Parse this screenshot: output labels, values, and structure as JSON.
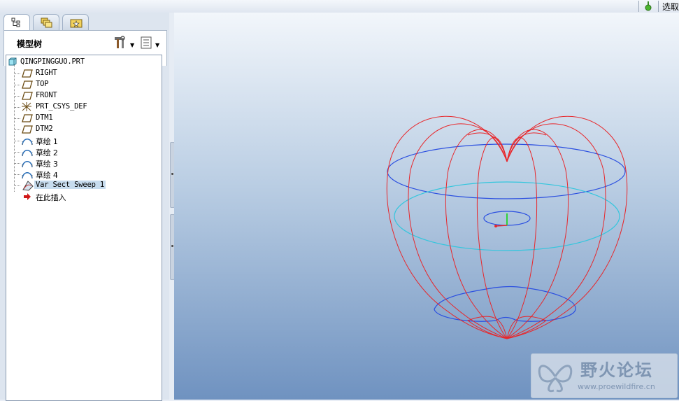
{
  "topbar": {
    "filter_label": "选取"
  },
  "model_tree": {
    "title": "模型树",
    "tabs": [
      {
        "icon": "model-tree-tab-icon"
      },
      {
        "icon": "folder-browser-tab-icon"
      },
      {
        "icon": "favorites-tab-icon"
      }
    ],
    "root": "QINGPINGGUO.PRT",
    "items": [
      {
        "label": "RIGHT",
        "icon": "datum-plane-icon"
      },
      {
        "label": "TOP",
        "icon": "datum-plane-icon"
      },
      {
        "label": "FRONT",
        "icon": "datum-plane-icon"
      },
      {
        "label": "PRT_CSYS_DEF",
        "icon": "coordinate-system-icon"
      },
      {
        "label": "DTM1",
        "icon": "datum-plane-icon"
      },
      {
        "label": "DTM2",
        "icon": "datum-plane-icon"
      },
      {
        "label": "草绘 1",
        "icon": "sketch-icon"
      },
      {
        "label": "草绘 2",
        "icon": "sketch-icon"
      },
      {
        "label": "草绘 3",
        "icon": "sketch-icon"
      },
      {
        "label": "草绘 4",
        "icon": "sketch-icon"
      },
      {
        "label": "Var Sect Sweep 1",
        "icon": "var-sect-sweep-icon"
      },
      {
        "label": "在此插入",
        "icon": "insert-here-arrow-icon"
      }
    ]
  },
  "watermark": {
    "title": "野火论坛",
    "url": "www.proewildfire.cn"
  },
  "colors": {
    "wireframe_edges": "#e8262a",
    "datum_curves_blue": "#2b4fe0",
    "datum_curve_cyan": "#33c6dd"
  }
}
